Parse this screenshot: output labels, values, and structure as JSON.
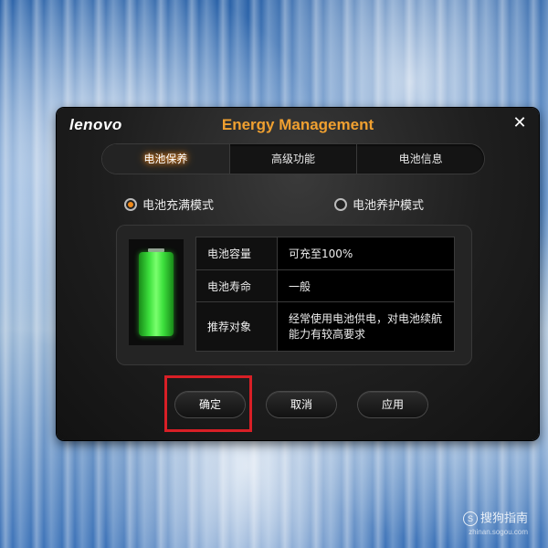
{
  "app": {
    "logo": "lenovo",
    "title": "Energy Management",
    "close_symbol": "✕"
  },
  "tabs": [
    {
      "label": "电池保养",
      "active": true
    },
    {
      "label": "高级功能",
      "active": false
    },
    {
      "label": "电池信息",
      "active": false
    }
  ],
  "modes": [
    {
      "label": "电池充满模式",
      "checked": true
    },
    {
      "label": "电池养护模式",
      "checked": false
    }
  ],
  "battery": {
    "level_fraction": 1.0,
    "color": "#3de03d"
  },
  "info_rows": [
    {
      "key": "电池容量",
      "value": "可充至100%"
    },
    {
      "key": "电池寿命",
      "value": "一般"
    },
    {
      "key": "推荐对象",
      "value": "经常使用电池供电，对电池续航能力有较高要求"
    }
  ],
  "buttons": {
    "confirm": "确定",
    "cancel": "取消",
    "apply": "应用"
  },
  "highlight": {
    "target": "confirm-button",
    "color": "#d81f26"
  },
  "watermark": {
    "text": "搜狗指南",
    "sub": "zhinan.sogou.com"
  },
  "colors": {
    "accent": "#f0a030",
    "radio_dot": "#f08a1a"
  }
}
